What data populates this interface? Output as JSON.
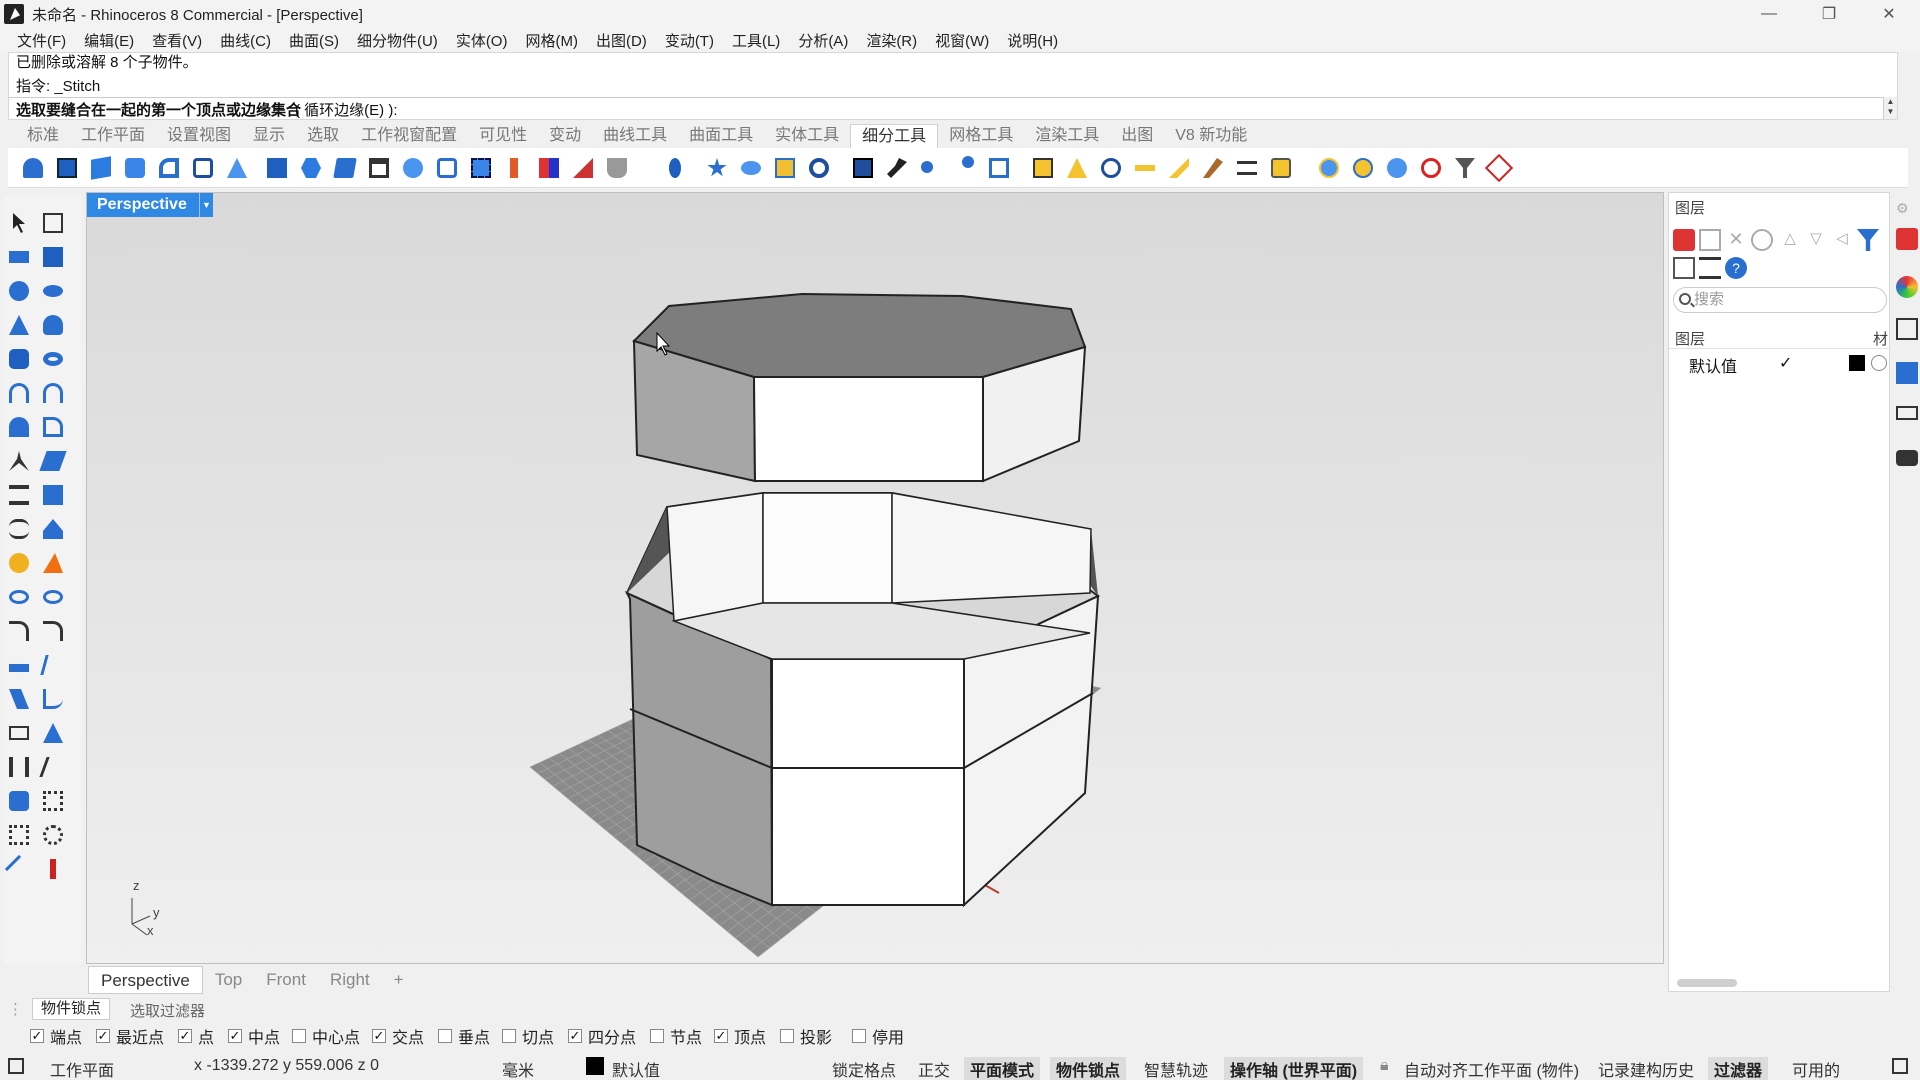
{
  "window": {
    "title": "未命名 - Rhinoceros 8 Commercial - [Perspective]",
    "controls": [
      "—",
      "❐",
      "✕"
    ]
  },
  "menu": [
    "文件(F)",
    "编辑(E)",
    "查看(V)",
    "曲线(C)",
    "曲面(S)",
    "细分物件(U)",
    "实体(O)",
    "网格(M)",
    "出图(D)",
    "变动(T)",
    "工具(L)",
    "分析(A)",
    "渲染(R)",
    "视窗(W)",
    "说明(H)"
  ],
  "command": {
    "history1": "已删除或溶解 8 个子物件。",
    "history2": "指令: _Stitch",
    "prompt_main": "选取要缝合在一起的第一个顶点或边缘集合",
    "prompt_option": "( 循环边缘(E) ):"
  },
  "toolbar_tabs": [
    "标准",
    "工作平面",
    "设置视图",
    "显示",
    "选取",
    "工作视窗配置",
    "可见性",
    "变动",
    "曲线工具",
    "曲面工具",
    "实体工具",
    "细分工具",
    "网格工具",
    "渲染工具",
    "出图",
    "V8 新功能"
  ],
  "active_tab": "细分工具",
  "viewport": {
    "title": "Perspective",
    "axes": {
      "z": "z",
      "y": "y",
      "x": "x"
    }
  },
  "viewport_tabs": [
    "Perspective",
    "Top",
    "Front",
    "Right",
    "+"
  ],
  "layers_panel": {
    "title": "图层",
    "search_placeholder": "搜索",
    "column_name": "图层",
    "column_material": "材",
    "rows": [
      {
        "name": "默认值",
        "current": "✓",
        "color": "#000000"
      }
    ]
  },
  "bottom_tabs": [
    "物件锁点",
    "选取过滤器"
  ],
  "osnaps": [
    {
      "label": "端点",
      "checked": true
    },
    {
      "label": "最近点",
      "checked": true
    },
    {
      "label": "点",
      "checked": true
    },
    {
      "label": "中点",
      "checked": true
    },
    {
      "label": "中心点",
      "checked": false
    },
    {
      "label": "交点",
      "checked": true
    },
    {
      "label": "垂点",
      "checked": false
    },
    {
      "label": "切点",
      "checked": false
    },
    {
      "label": "四分点",
      "checked": true
    },
    {
      "label": "节点",
      "checked": false
    },
    {
      "label": "顶点",
      "checked": true
    },
    {
      "label": "投影",
      "checked": false
    },
    {
      "label": "停用",
      "checked": false
    }
  ],
  "status": {
    "cplane": "工作平面",
    "coords": "x -1339.272  y 559.006  z 0",
    "units": "毫米",
    "layer": "默认值",
    "grid_snap": "锁定格点",
    "ortho": "正交",
    "planar": "平面模式",
    "osnap": "物件锁点",
    "smarttrack": "智慧轨迹",
    "gumball": "操作轴 (世界平面)",
    "autoalign": "自动对齐工作平面 (物件)",
    "history": "记录建构历史",
    "filter": "过滤器",
    "memory": "可用的"
  },
  "colors": {
    "viewport_title_bg": "#2f88e4",
    "x_axis": "#c0392b"
  }
}
